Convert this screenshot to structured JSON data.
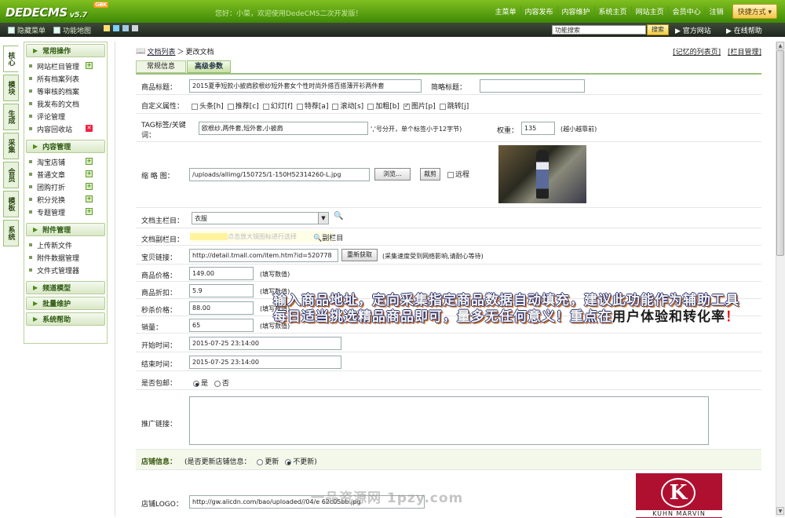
{
  "header": {
    "logo_text": "DEDECMS",
    "version": "v5.7",
    "badge": "GBK",
    "welcome": "您好：小菜，欢迎使用DedeCMS二次开发版！",
    "nav": [
      "主菜单",
      "内容发布",
      "内容维护",
      "系统主页",
      "网站主页",
      "会员中心",
      "注销"
    ],
    "quick_button": "快捷方式 ▾"
  },
  "subbar": {
    "hide_menu": "隐藏菜单",
    "sitemap": "功能地图",
    "search_placeholder": "功能搜索",
    "search_button": "搜索",
    "official": "官方网站",
    "online_help": "在线帮助"
  },
  "vtabs": [
    "核心",
    "模块",
    "生成",
    "采集",
    "会员",
    "模板",
    "系统"
  ],
  "sidebar": {
    "sections": [
      {
        "title": "常用操作",
        "items": [
          {
            "label": "网站栏目管理",
            "mark": "plus"
          },
          {
            "label": "所有档案列表",
            "mark": ""
          },
          {
            "label": "等审核的档案",
            "mark": ""
          },
          {
            "label": "我发布的文档",
            "mark": ""
          },
          {
            "label": "评论管理",
            "mark": ""
          },
          {
            "label": "内容回收站",
            "mark": "x"
          }
        ]
      },
      {
        "title": "内容管理",
        "items": [
          {
            "label": "淘宝店铺",
            "mark": "plus"
          },
          {
            "label": "普通文章",
            "mark": "plus"
          },
          {
            "label": "团购打折",
            "mark": "plus"
          },
          {
            "label": "积分兑换",
            "mark": "plus"
          },
          {
            "label": "专题管理",
            "mark": "plus"
          }
        ]
      },
      {
        "title": "附件管理",
        "items": [
          {
            "label": "上传新文件",
            "mark": ""
          },
          {
            "label": "附件数据管理",
            "mark": ""
          },
          {
            "label": "文件式管理器",
            "mark": ""
          }
        ]
      },
      {
        "title": "频道模型",
        "items": []
      },
      {
        "title": "批量维护",
        "items": []
      },
      {
        "title": "系统帮助",
        "items": []
      }
    ]
  },
  "breadcrumb": {
    "list": "文档列表",
    "sep": "＞",
    "current": "更改文档"
  },
  "right_links": [
    "[记忆的列表页]",
    "[栏目管理]"
  ],
  "tabs": [
    "常规信息",
    "高级参数"
  ],
  "form": {
    "title_label": "商品标题：",
    "title_value": "2015夏季短款小披肩欧根纱短外套女个性时尚外搭百搭薄开衫两件套",
    "short_title_label": "简略标题：",
    "short_title_value": "",
    "attr_label": "自定义属性：",
    "attrs": [
      {
        "label": "头条[h]",
        "on": false
      },
      {
        "label": "推荐[c]",
        "on": false
      },
      {
        "label": "幻灯[f]",
        "on": false
      },
      {
        "label": "特荐[a]",
        "on": false
      },
      {
        "label": "滚动[s]",
        "on": false
      },
      {
        "label": "加粗[b]",
        "on": false
      },
      {
        "label": "图片[p]",
        "on": true
      },
      {
        "label": "跳转[j]",
        "on": false
      }
    ],
    "tags_label": "TAG标签/关键词：",
    "tags_value": "欧根纱,两件套,短外套,小披肩",
    "tags_hint": "','号分开，单个标签小于12字节)",
    "weight_label": "权重：",
    "weight_value": "135",
    "weight_hint": "(越小越靠前)",
    "thumb_label": "缩 略 图：",
    "thumb_value": "/uploads/allimg/150725/1-150H52314260-L.jpg",
    "browse_btn": "浏览...",
    "crop_btn": "裁剪",
    "remote_label": "远程",
    "main_cat_label": "文档主栏目：",
    "main_cat_value": "衣服",
    "sub_cat_label": "文档副栏目：",
    "sub_cat_hint": "点击放大镜图标进行选择",
    "sub_cat_link": "副栏目",
    "link_label": "宝贝链接：",
    "link_value": "http://detail.tmall.com/item.htm?id=520778",
    "refetch_btn": "重新获取",
    "link_hint": "(采集速度受到网络影响,请耐心等待)",
    "price_label": "商品价格：",
    "price_value": "149.00",
    "price_hint": "(填写数值)",
    "discount_label": "商品折扣：",
    "discount_value": "5.9",
    "discount_hint": "(填写数值)",
    "flash_label": "秒杀价格：",
    "flash_value": "88.00",
    "flash_hint": "(填写数值)",
    "sales_label": "销量：",
    "sales_value": "65",
    "sales_hint": "(填写数值)",
    "start_label": "开始时间：",
    "start_value": "2015-07-25 23:14:00",
    "end_label": "结束时间：",
    "end_value": "2015-07-25 23:14:00",
    "free_ship_label": "是否包邮：",
    "free_ship_yes": "是",
    "free_ship_no": "否",
    "promo_label": "推广链接：",
    "shop_label": "店铺信息：",
    "shop_update_q": "(是否更新店铺信息：",
    "shop_update": "更新",
    "shop_noupdate": "不更新)",
    "shop_logo_label": "店铺LOGO：",
    "shop_logo_value": "http://gw.alicdn.com/bao/uploaded//04/e 62c05bb.jpg",
    "logo_brand": "KUHN MARVIN",
    "logo_mark": "K"
  },
  "overlay": {
    "line1": "输入商品地址，定向采集指定商品数据自动填充，建议此功能作为辅助工具",
    "line2a": "每日适当挑选精品商品即可，量多无任何意义！重点在",
    "line2b": "用户体验和转化率",
    "line2c": "！"
  },
  "watermark": "一品资源网 1pzy.com",
  "colors": {
    "header_green": "#4f9a0e",
    "accent_orange": "#f0c040",
    "overlay_blue": "#2a3070",
    "overlay_red": "#e81010"
  }
}
